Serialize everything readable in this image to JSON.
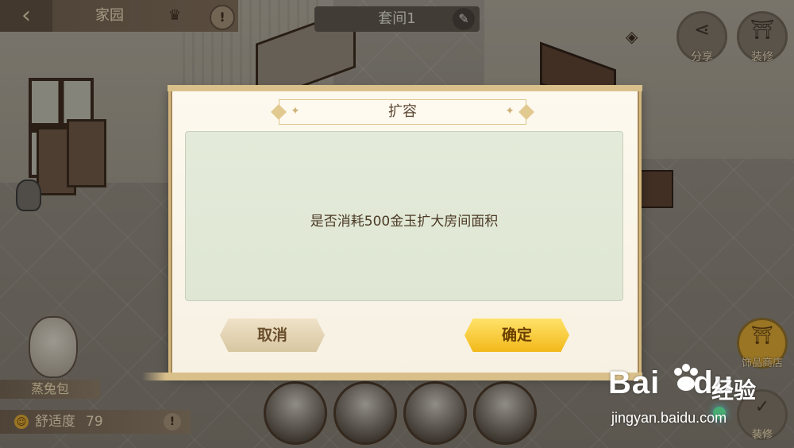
{
  "topbar": {
    "back_icon": "back-arrow-icon",
    "title": "家园",
    "crown_icon": "crown-icon",
    "warning_icon": "warning-icon",
    "warning_glyph": "!"
  },
  "room": {
    "label": "套间1",
    "edit_icon": "rename-icon"
  },
  "right_buttons": {
    "share_label": "分享",
    "decorate_label": "装修"
  },
  "decoration": {
    "name": "蒸兔包"
  },
  "comfort": {
    "label": "舒适度",
    "value": "79",
    "icon": "smile-icon",
    "warning_glyph": "!"
  },
  "right_side": {
    "shop_label": "饰品商店",
    "save_label": "装修"
  },
  "dialog": {
    "title": "扩容",
    "message": "是否消耗500金玉扩大房间面积",
    "cancel_label": "取消",
    "confirm_label": "确定"
  },
  "watermark": {
    "brand": "Bai",
    "brand_suffix": "du",
    "jingyan": "经验",
    "url": "jingyan.baidu.com"
  }
}
